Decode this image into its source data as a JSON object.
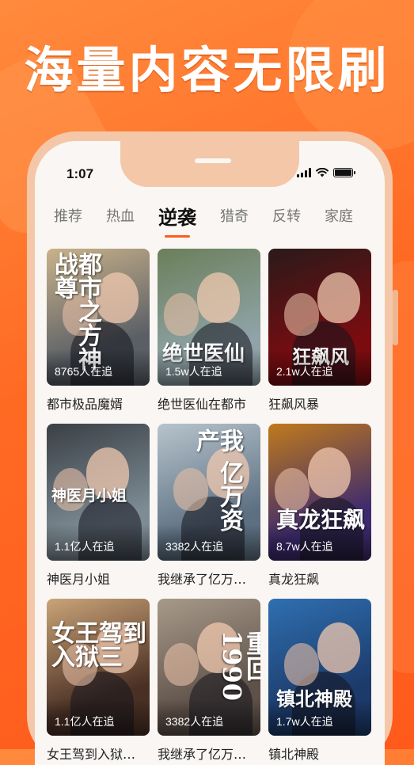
{
  "headline": "海量内容无限刷",
  "status_bar": {
    "time": "1:07"
  },
  "tabs": [
    {
      "label": "推荐",
      "active": false
    },
    {
      "label": "热血",
      "active": false
    },
    {
      "label": "逆袭",
      "active": true
    },
    {
      "label": "猎奇",
      "active": false
    },
    {
      "label": "反转",
      "active": false
    },
    {
      "label": "家庭",
      "active": false
    }
  ],
  "dramas": [
    {
      "title": "都市极品魔婿",
      "count": "8765人在追",
      "poster_text": "都市之方神战尊",
      "palette": [
        "#5a5f66",
        "#c9b28a"
      ]
    },
    {
      "title": "绝世医仙在都市",
      "count": "1.5w人在追",
      "poster_text": "绝世医仙",
      "palette": [
        "#8fa3a8",
        "#6b7f5a"
      ]
    },
    {
      "title": "狂飙风暴",
      "count": "2.1w人在追",
      "poster_text": "狂飙风",
      "palette": [
        "#7a0c10",
        "#2a1a1a"
      ]
    },
    {
      "title": "神医月小姐",
      "count": "1.1亿人在追",
      "poster_text": "神医月小姐",
      "palette": [
        "#7d8c95",
        "#3a3f45"
      ]
    },
    {
      "title": "我继承了亿万…",
      "count": "3382人在追",
      "poster_text": "我 亿万资产",
      "palette": [
        "#5d7082",
        "#b7c4cc"
      ]
    },
    {
      "title": "真龙狂飙",
      "count": "8.7w人在追",
      "poster_text": "真龙狂飙",
      "palette": [
        "#3d2a6e",
        "#c07a1c"
      ]
    },
    {
      "title": "女王驾到入狱…",
      "count": "1.1亿人在追",
      "poster_text": "女王驾到 入狱三",
      "palette": [
        "#4a3024",
        "#caa478"
      ]
    },
    {
      "title": "我继承了亿万…",
      "count": "3382人在追",
      "poster_text": "重回1990",
      "palette": [
        "#5e5148",
        "#a89a8a"
      ]
    },
    {
      "title": "镇北神殿",
      "count": "1.7w人在追",
      "poster_text": "镇北神殿",
      "palette": [
        "#1c3a6a",
        "#2f6fb0"
      ]
    }
  ],
  "colors": {
    "accent": "#ff5a1c",
    "background": "#ff6a23"
  }
}
